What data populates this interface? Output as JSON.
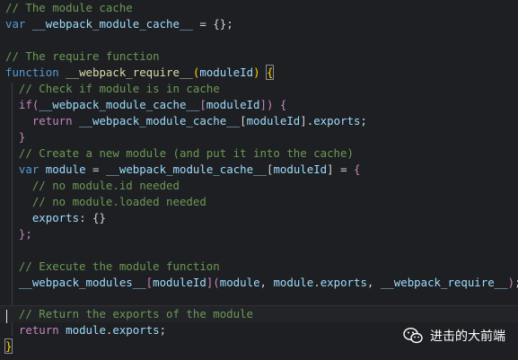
{
  "code": {
    "l1_comment": "// The module cache",
    "l2_kw": "var",
    "l2_name": "__webpack_module_cache__",
    "l2_rest": " = {};",
    "l4_comment": "// The require function",
    "l5_kw": "function",
    "l5_name": "__webpack_require__",
    "l5_param": "moduleId",
    "l6_comment": "// Check if module is in cache",
    "l7_kw": "if",
    "l7_cache": "__webpack_module_cache__",
    "l7_param": "moduleId",
    "l8_kw": "return",
    "l8_cache": "__webpack_module_cache__",
    "l8_param": "moduleId",
    "l8_prop": "exports",
    "l9_text": "}",
    "l10_comment": "// Create a new module (and put it into the cache)",
    "l11_kw": "var",
    "l11_module": "module",
    "l11_cache": "__webpack_module_cache__",
    "l11_param": "moduleId",
    "l12_comment": "// no module.id needed",
    "l13_comment": "// no module.loaded needed",
    "l14_prop": "exports",
    "l15_text": "};",
    "l17_comment": "// Execute the module function",
    "l18_fn": "__webpack_modules__",
    "l18_param": "moduleId",
    "l18_arg1": "module",
    "l18_arg2a": "module",
    "l18_arg2b": "exports",
    "l18_arg3": "__webpack_require__",
    "l20_comment": "// Return the exports of the module",
    "l21_kw": "return",
    "l21_module": "module",
    "l21_prop": "exports",
    "l22_text": "}"
  },
  "watermark": {
    "label": "进击的大前端",
    "icon": "wechat-icon"
  },
  "colors": {
    "background": "#1e1f22",
    "comment": "#6a9955",
    "keyword": "#569cd6",
    "control": "#c586c0",
    "variable": "#9cdcfe",
    "function": "#dcdcaa"
  }
}
